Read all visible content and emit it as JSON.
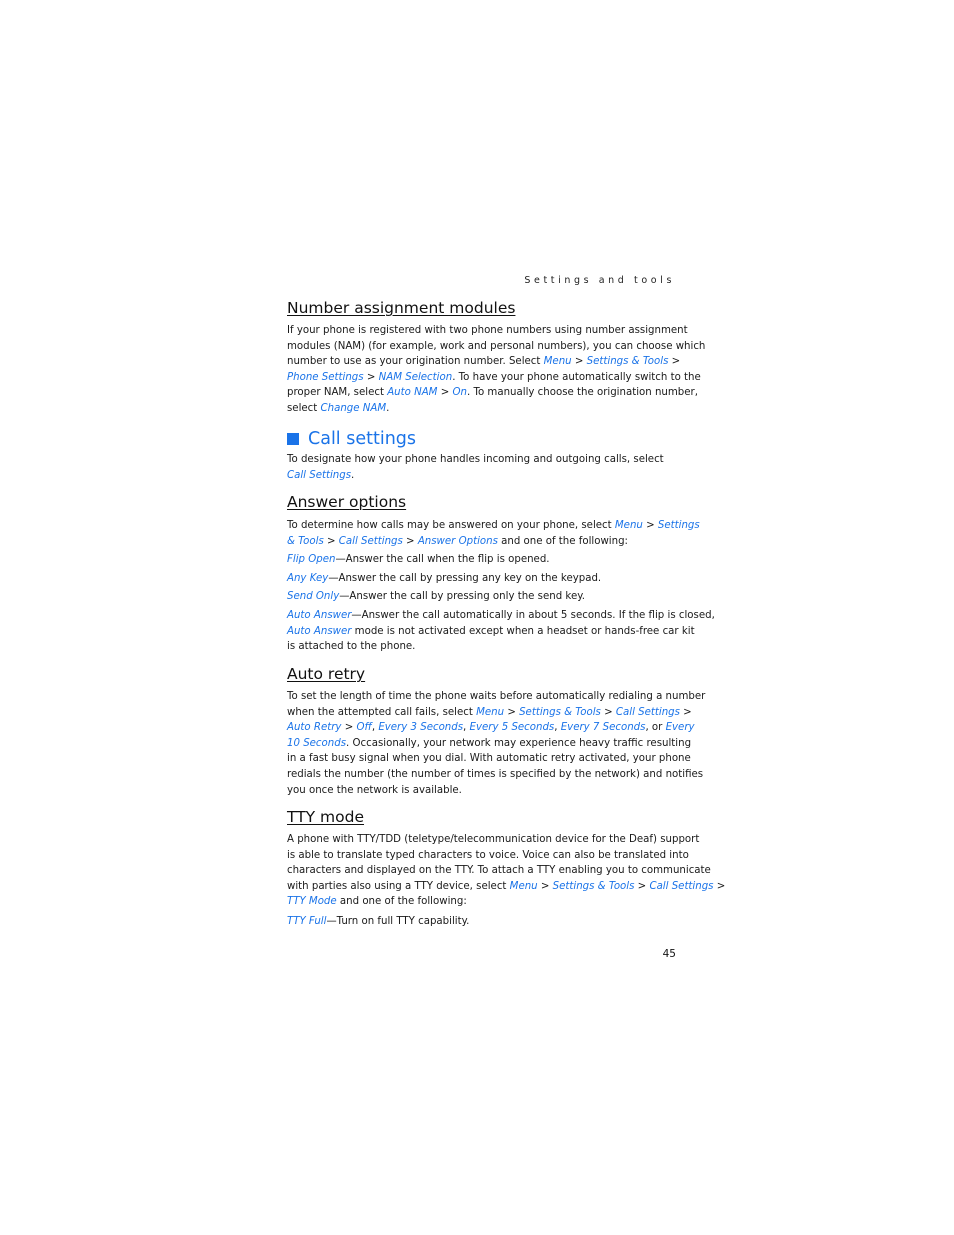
{
  "running_head": "Settings and tools",
  "page_number": "45",
  "link_color": "#1a73e8",
  "sections": {
    "nam": {
      "heading": "Number assignment modules",
      "lines": [
        [
          {
            "t": "If your phone is registered with two phone numbers using number assignment"
          }
        ],
        [
          {
            "t": "modules (NAM) (for example, work and personal numbers), you can choose which"
          }
        ],
        [
          {
            "t": "number to use as your origination number. Select "
          },
          {
            "t": "Menu",
            "l": true
          },
          {
            "t": " > "
          },
          {
            "t": "Settings & Tools",
            "l": true
          },
          {
            "t": " >"
          }
        ],
        [
          {
            "t": "Phone Settings",
            "l": true
          },
          {
            "t": " > "
          },
          {
            "t": "NAM Selection",
            "l": true
          },
          {
            "t": ". To have your phone automatically switch to the"
          }
        ],
        [
          {
            "t": "proper NAM, select "
          },
          {
            "t": "Auto NAM",
            "l": true
          },
          {
            "t": " > "
          },
          {
            "t": "On",
            "l": true
          },
          {
            "t": ". To manually choose the origination number,"
          }
        ],
        [
          {
            "t": "select "
          },
          {
            "t": "Change NAM",
            "l": true
          },
          {
            "t": "."
          }
        ]
      ]
    },
    "call_settings": {
      "heading": "Call settings",
      "lines": [
        [
          {
            "t": "To designate how your phone handles incoming and outgoing calls, select"
          }
        ],
        [
          {
            "t": "Call Settings",
            "l": true
          },
          {
            "t": "."
          }
        ]
      ]
    },
    "answer_options": {
      "heading": "Answer options",
      "intro": [
        [
          {
            "t": "To determine how calls may be answered on your phone, select "
          },
          {
            "t": "Menu",
            "l": true
          },
          {
            "t": " > "
          },
          {
            "t": "Settings",
            "l": true
          }
        ],
        [
          {
            "t": "& Tools",
            "l": true
          },
          {
            "t": " > "
          },
          {
            "t": "Call Settings",
            "l": true
          },
          {
            "t": " > "
          },
          {
            "t": "Answer Options",
            "l": true
          },
          {
            "t": " and one of the following:"
          }
        ]
      ],
      "options": [
        [
          [
            {
              "t": "Flip Open",
              "l": true
            },
            {
              "t": "—Answer the call when the flip is opened."
            }
          ]
        ],
        [
          [
            {
              "t": "Any Key",
              "l": true
            },
            {
              "t": "—Answer the call by pressing any key on the keypad."
            }
          ]
        ],
        [
          [
            {
              "t": "Send Only",
              "l": true
            },
            {
              "t": "—Answer the call by pressing only the send key."
            }
          ]
        ],
        [
          [
            {
              "t": "Auto Answer",
              "l": true
            },
            {
              "t": "—Answer the call automatically in about 5 seconds. If the flip is closed,"
            }
          ],
          [
            {
              "t": "Auto Answer",
              "l": true
            },
            {
              "t": " mode is not activated except when a headset or hands-free car kit"
            }
          ],
          [
            {
              "t": "is attached to the phone."
            }
          ]
        ]
      ]
    },
    "auto_retry": {
      "heading": "Auto retry",
      "lines": [
        [
          {
            "t": "To set the length of time the phone waits before automatically redialing a number"
          }
        ],
        [
          {
            "t": "when the attempted call fails, select "
          },
          {
            "t": "Menu",
            "l": true
          },
          {
            "t": " > "
          },
          {
            "t": "Settings & Tools",
            "l": true
          },
          {
            "t": " > "
          },
          {
            "t": "Call Settings",
            "l": true
          },
          {
            "t": " >"
          }
        ],
        [
          {
            "t": "Auto Retry",
            "l": true
          },
          {
            "t": " > "
          },
          {
            "t": "Off",
            "l": true
          },
          {
            "t": ", "
          },
          {
            "t": "Every 3 Seconds",
            "l": true
          },
          {
            "t": ", "
          },
          {
            "t": "Every 5 Seconds",
            "l": true
          },
          {
            "t": ", "
          },
          {
            "t": "Every 7 Seconds",
            "l": true
          },
          {
            "t": ", or "
          },
          {
            "t": "Every",
            "l": true
          }
        ],
        [
          {
            "t": "10 Seconds",
            "l": true
          },
          {
            "t": ". Occasionally, your network may experience heavy traffic resulting"
          }
        ],
        [
          {
            "t": "in a fast busy signal when you dial. With automatic retry activated, your phone"
          }
        ],
        [
          {
            "t": "redials the number (the number of times is specified by the network) and notifies"
          }
        ],
        [
          {
            "t": "you once the network is available."
          }
        ]
      ]
    },
    "tty_mode": {
      "heading": "TTY mode",
      "lines": [
        [
          {
            "t": "A phone with TTY/TDD (teletype/telecommunication device for the Deaf) support"
          }
        ],
        [
          {
            "t": "is able to translate typed characters to voice. Voice can also be translated into"
          }
        ],
        [
          {
            "t": "characters and displayed on the TTY. To attach a TTY enabling you to communicate"
          }
        ],
        [
          {
            "t": "with parties also using a TTY device, select "
          },
          {
            "t": "Menu",
            "l": true
          },
          {
            "t": " > "
          },
          {
            "t": "Settings & Tools",
            "l": true
          },
          {
            "t": " > "
          },
          {
            "t": "Call Settings",
            "l": true
          },
          {
            "t": " >"
          }
        ],
        [
          {
            "t": "TTY Mode",
            "l": true
          },
          {
            "t": " and one of the following:"
          }
        ]
      ],
      "options": [
        [
          [
            {
              "t": "TTY Full",
              "l": true
            },
            {
              "t": "—Turn on full TTY capability."
            }
          ]
        ]
      ]
    }
  }
}
